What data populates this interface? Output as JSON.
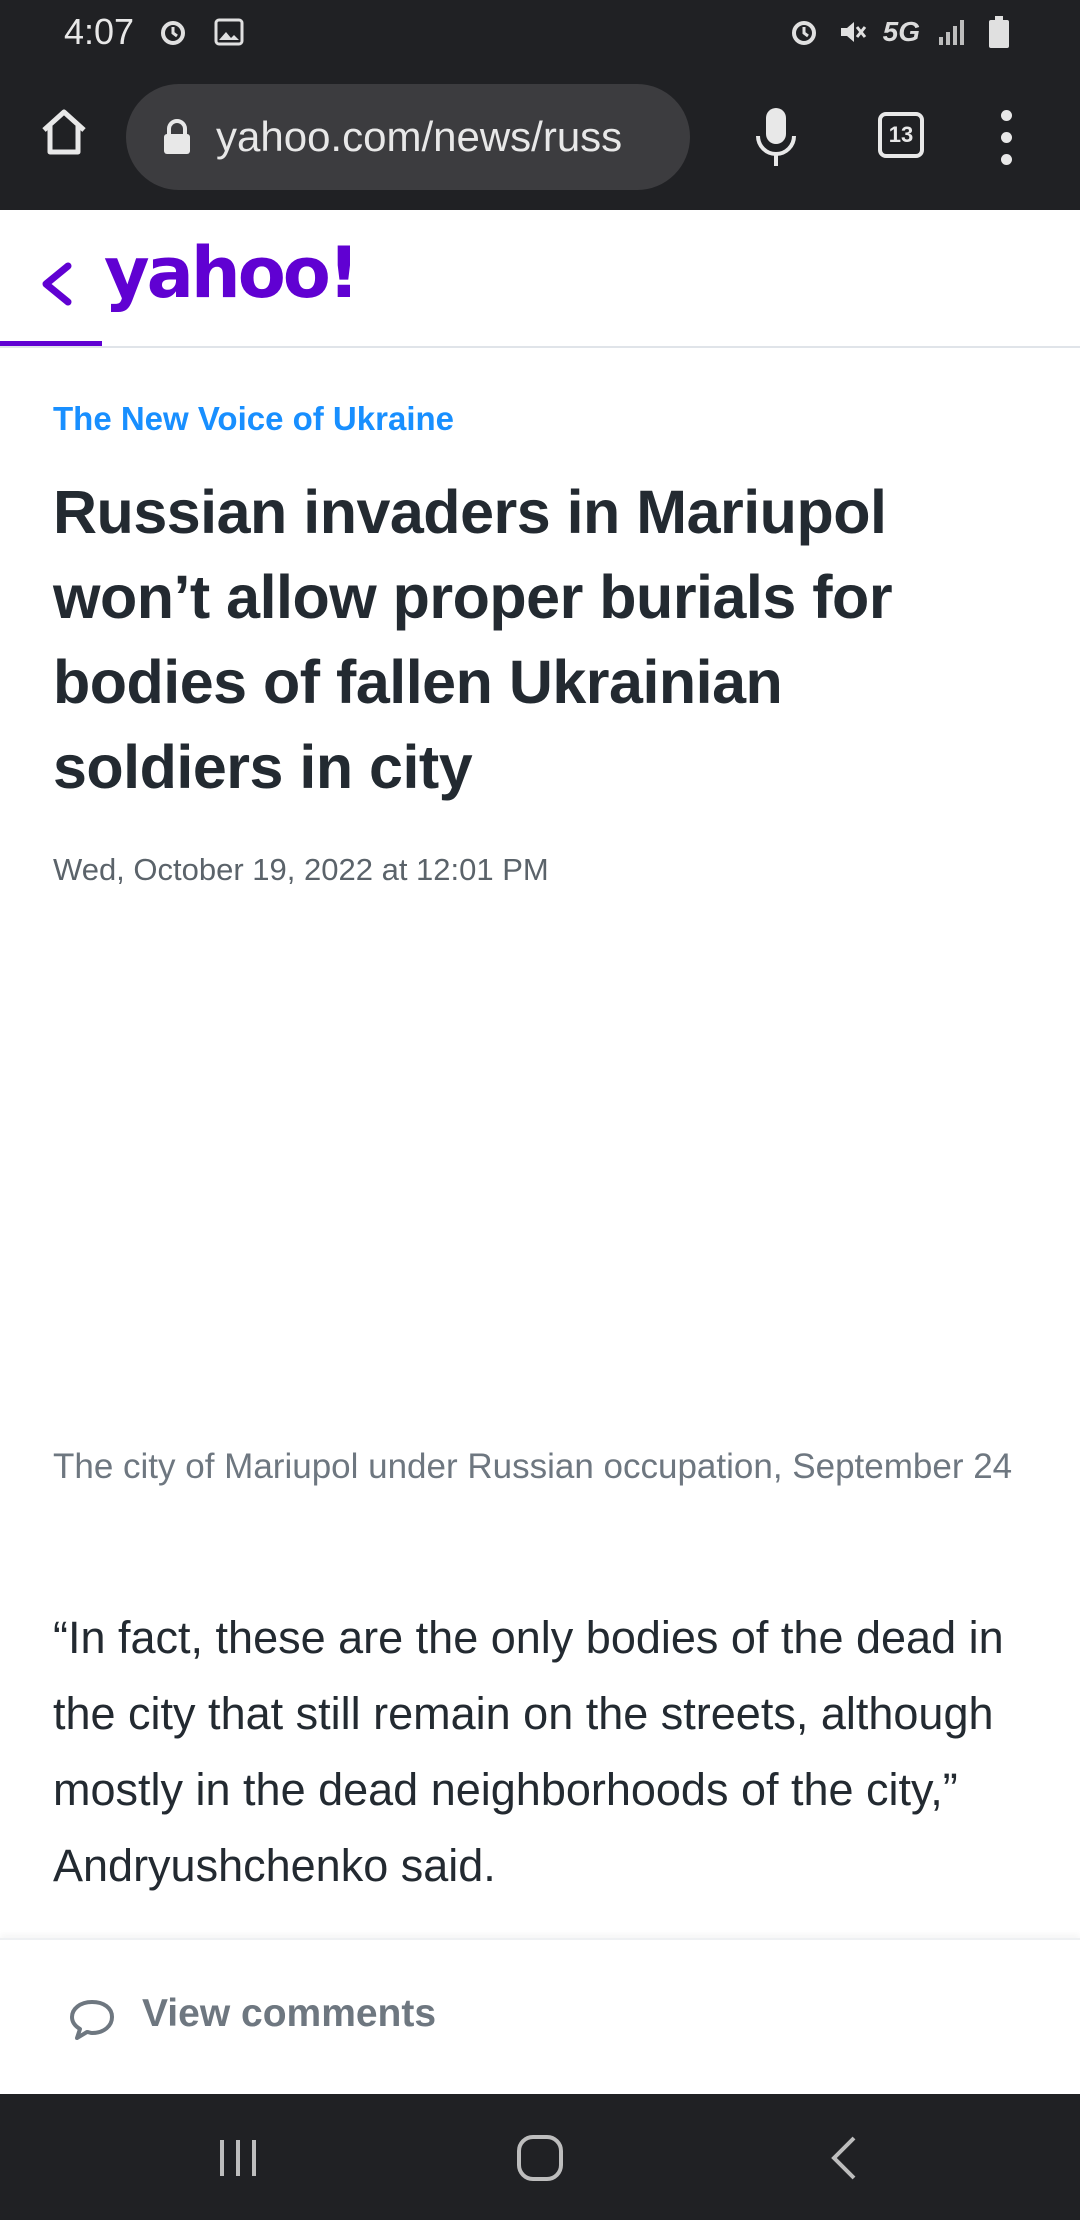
{
  "status_bar": {
    "time": "4:07",
    "network": "5G",
    "icons": [
      "alarm-icon",
      "image-icon",
      "alarm-icon",
      "mute-icon",
      "signal-icon",
      "battery-icon"
    ]
  },
  "browser": {
    "url": "yahoo.com/news/russ",
    "tab_count": "13"
  },
  "header": {
    "logo_text": "yahoo!",
    "brand_color": "#6001d2"
  },
  "article": {
    "provider": "The New Voice of Ukraine",
    "headline": "Russian invaders in Mariupol won’t allow proper burials for bodies of fallen Ukrainian soldiers in city",
    "date": "Wed, October 19, 2022 at 12:01 PM",
    "caption": "The city of Mariupol under Russian occupation, September 24",
    "paragraph": "“In fact, these are the only bodies of the dead in the city that still remain on the streets, although mostly in the dead neighborhoods of the city,” Andryushchenko said."
  },
  "comments": {
    "label": "View comments"
  },
  "colors": {
    "provider_link": "#188fff",
    "headline_text": "#232a31",
    "chrome_bg": "#202124"
  }
}
